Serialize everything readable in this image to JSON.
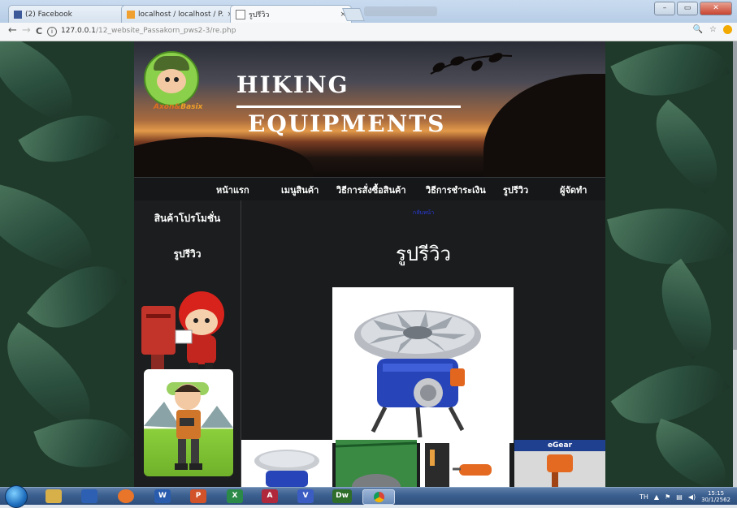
{
  "browser": {
    "tabs": [
      {
        "title": "(2) Facebook",
        "close": "×"
      },
      {
        "title": "localhost / localhost / P...",
        "close": "×"
      },
      {
        "title": "รูปรีวิว",
        "close": "×"
      }
    ],
    "url_host": "127.0.0.1",
    "url_path": "/12_website_Passakorn_pws2-3/re.php",
    "window_buttons": [
      "–",
      "▭",
      "✕"
    ],
    "nav_icons": {
      "back": "←",
      "forward": "→",
      "reload": "C"
    },
    "addr_icons": {
      "zoom": "🔍",
      "star": "☆"
    }
  },
  "site": {
    "banner": {
      "title_line1": "HIKING",
      "title_line2": "EQUIPMENTS",
      "logo_text_a": "Axon&",
      "logo_text_b": "Basix"
    },
    "nav": [
      "หน้าแรก",
      "เมนูสินค้า",
      "วิธีการสั่งซื้อสินค้า",
      "วิธีการชำระเงิน",
      "รูปรีวิว",
      "ผู้จัดทำ"
    ],
    "sidebar": [
      "สินค้าโปรโมชั่น",
      "รูปรีวิว"
    ],
    "main": {
      "small_link": "กลับหน้า",
      "page_title": "รูปรีวิว"
    },
    "thumb4_label": "eGear"
  },
  "taskbar": {
    "apps": [
      "",
      "",
      "",
      "W",
      "P",
      "X",
      "A",
      "V",
      "Dw",
      ""
    ],
    "lang": "TH",
    "time": "15:15",
    "date": "30/1/2562"
  }
}
